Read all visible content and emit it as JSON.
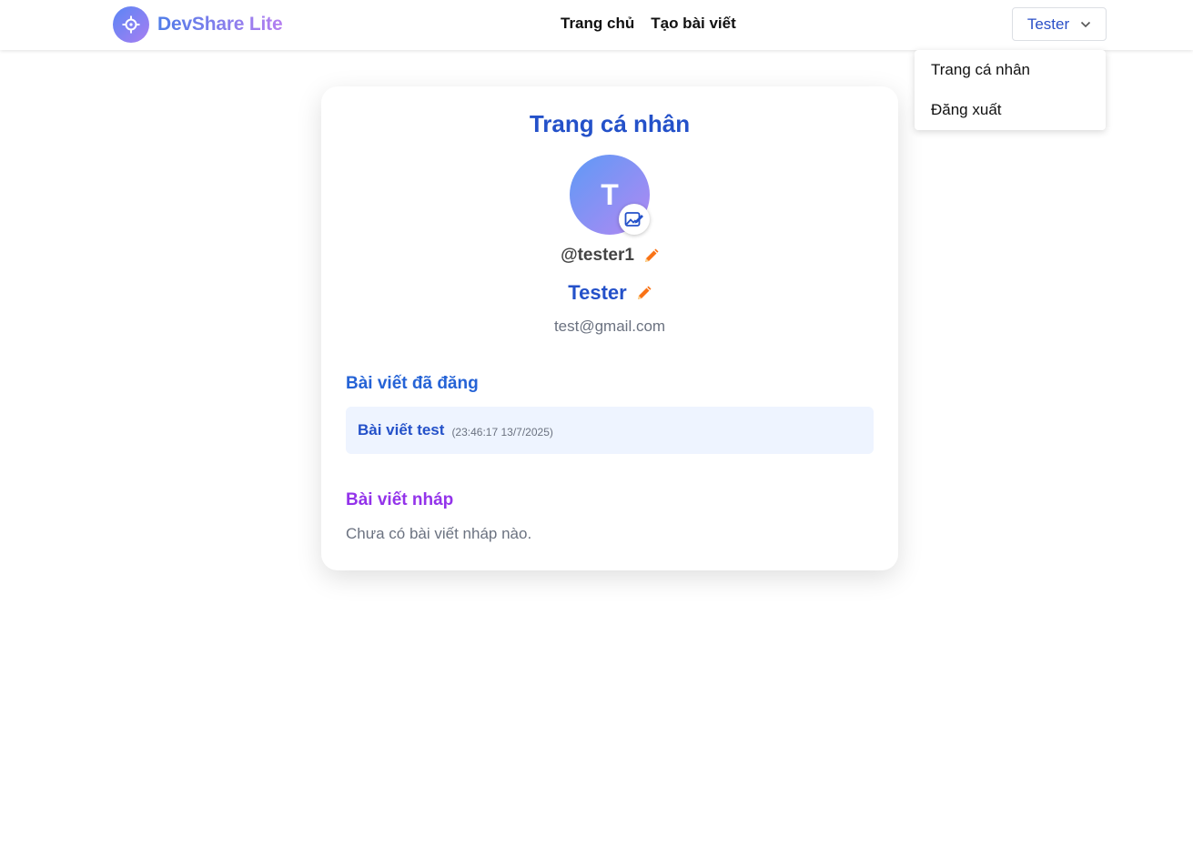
{
  "header": {
    "brand": "DevShare Lite",
    "nav": [
      {
        "label": "Trang chủ"
      },
      {
        "label": "Tạo bài viết"
      }
    ],
    "user_button": "Tester"
  },
  "dropdown": {
    "items": [
      {
        "label": "Trang cá nhân"
      },
      {
        "label": "Đăng xuất"
      }
    ]
  },
  "profile": {
    "title": "Trang cá nhân",
    "avatar_letter": "T",
    "username": "@tester1",
    "display_name": "Tester",
    "email": "test@gmail.com"
  },
  "published": {
    "title": "Bài viết đã đăng",
    "posts": [
      {
        "title": "Bài viết test",
        "time": "(23:46:17 13/7/2025)"
      }
    ]
  },
  "drafts": {
    "title": "Bài viết nháp",
    "empty_text": "Chưa có bài viết nháp nào."
  },
  "colors": {
    "primary": "#2451c9",
    "draft_title": "#9333ea",
    "pencil": "#f97316",
    "post_bg": "#eef4ff"
  },
  "icons": {
    "logo": "crosshair-icon",
    "dropdown": "chevron-down-icon",
    "avatar_edit": "image-edit-icon",
    "edit": "pencil-icon"
  }
}
